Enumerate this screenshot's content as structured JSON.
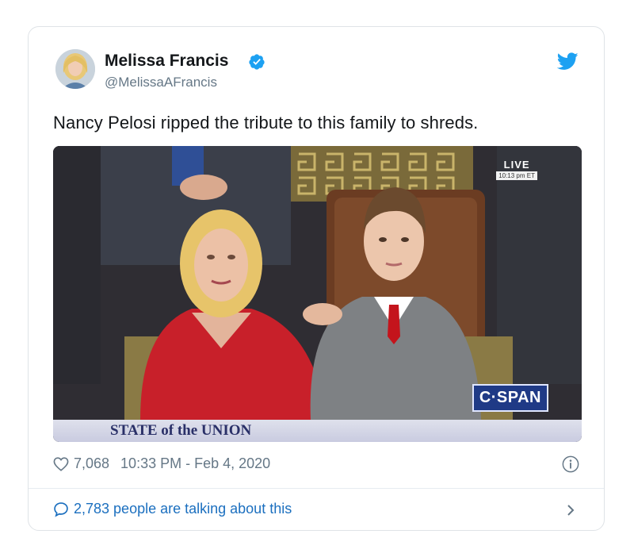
{
  "tweet": {
    "author_name": "Melissa Francis",
    "handle": "@MelissaAFrancis",
    "text": "Nancy Pelosi ripped the tribute to this family to shreds.",
    "likes": "7,068",
    "timestamp": "10:33 PM - Feb 4, 2020",
    "conversation": "2,783 people are talking about this"
  },
  "media": {
    "live_label": "LIVE",
    "live_time": "10:13 pm ET",
    "network_logo": "C·SPAN",
    "banner": "STATE of the UNION"
  },
  "icons": {
    "verified": "verified-badge-icon",
    "twitter": "twitter-bird-icon",
    "like": "heart-icon",
    "info": "info-icon",
    "reply": "speech-bubble-icon",
    "chevron": "chevron-right-icon"
  },
  "colors": {
    "brand_blue": "#1da1f2",
    "link_blue": "#1b6fbf",
    "muted": "#657786"
  }
}
